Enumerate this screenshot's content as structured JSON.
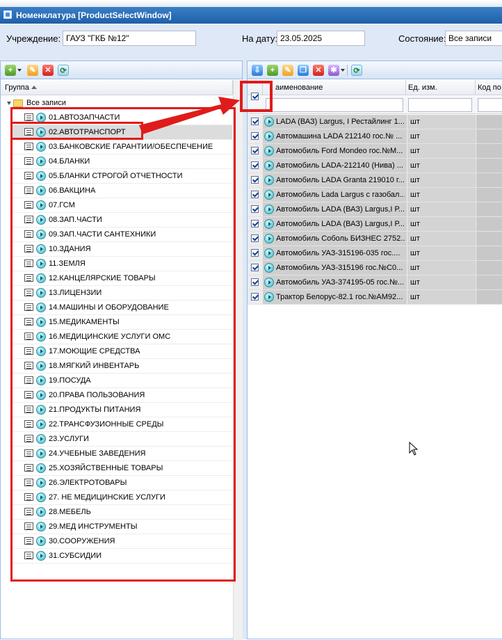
{
  "window": {
    "title": "Номенклатура [ProductSelectWindow]"
  },
  "filters": {
    "institution_label": "Учреждение:",
    "institution_value": "ГАУЗ \"ГКБ №12\"",
    "date_label": "На дату:",
    "date_value": "23.05.2025",
    "state_label": "Состояние:",
    "state_value": "Все записи"
  },
  "left_panel": {
    "column_header": "Группа",
    "root_label": "Все записи",
    "selected_index": 1,
    "groups": [
      "01.АВТОЗАПЧАСТИ",
      "02.АВТОТРАНСПОРТ",
      "03.БАНКОВСКИЕ ГАРАНТИИ/ОБЕСПЕЧЕНИЕ",
      "04.БЛАНКИ",
      "05.БЛАНКИ СТРОГОЙ ОТЧЕТНОСТИ",
      "06.ВАКЦИНА",
      "07.ГСМ",
      "08.ЗАП.ЧАСТИ",
      "09.ЗАП.ЧАСТИ САНТЕХНИКИ",
      "10.ЗДАНИЯ",
      "11.ЗЕМЛЯ",
      "12.КАНЦЕЛЯРСКИЕ ТОВАРЫ",
      "13.ЛИЦЕНЗИИ",
      "14.МАШИНЫ И ОБОРУДОВАНИЕ",
      "15.МЕДИКАМЕНТЫ",
      "16.МЕДИЦИНСКИЕ УСЛУГИ ОМС",
      "17.МОЮЩИЕ СРЕДСТВА",
      "18.МЯГКИЙ ИНВЕНТАРЬ",
      "19.ПОСУДА",
      "20.ПРАВА ПОЛЬЗОВАНИЯ",
      "21.ПРОДУКТЫ ПИТАНИЯ",
      "22.ТРАНСФУЗИОННЫЕ СРЕДЫ",
      "23.УСЛУГИ",
      "24.УЧЕБНЫЕ ЗАВЕДЕНИЯ",
      "25.ХОЗЯЙСТВЕННЫЕ ТОВАРЫ",
      "26.ЭЛЕКТРОТОВАРЫ",
      "27. НЕ МЕДИЦИНСКИЕ УСЛУГИ",
      "28.МЕБЕЛЬ",
      "29.МЕД ИНСТРУМЕНТЫ",
      "30.СООРУЖЕНИЯ",
      "31.СУБСИДИИ"
    ]
  },
  "right_panel": {
    "columns": {
      "name": "аименование",
      "unit": "Ед. изм.",
      "code": "Код по"
    },
    "header_checkbox_checked": true,
    "rows": [
      {
        "name": "LADA (ВАЗ) Largus, I Рестайлинг 1...",
        "unit": "шт",
        "checked": true
      },
      {
        "name": "Автомашина LADA 212140 гос.№ ...",
        "unit": "шт",
        "checked": true
      },
      {
        "name": "Автомобиль Ford Mondeo гос.№М...",
        "unit": "шт",
        "checked": true
      },
      {
        "name": "Автомобиль LADA-212140 (Нива) ...",
        "unit": "шт",
        "checked": true
      },
      {
        "name": "Автомобиль LADA Granta 219010 г...",
        "unit": "шт",
        "checked": true
      },
      {
        "name": "Автомобиль Lada Largus с газобал...",
        "unit": "шт",
        "checked": true
      },
      {
        "name": "Автомобиль LADA (ВАЗ) Largus,I Р...",
        "unit": "шт",
        "checked": true
      },
      {
        "name": "Автомобиль LADA (ВАЗ) Largus,I Р...",
        "unit": "шт",
        "checked": true
      },
      {
        "name": "Автомобиль Соболь БИЗНЕС 2752...",
        "unit": "шт",
        "checked": true
      },
      {
        "name": "Автомобиль УАЗ-315196-035 гос....",
        "unit": "шт",
        "checked": true
      },
      {
        "name": "Автомобиль УАЗ-315196 гос.№С0...",
        "unit": "шт",
        "checked": true
      },
      {
        "name": "Автомобиль УАЗ-374195-05 гос.№...",
        "unit": "шт",
        "checked": true
      },
      {
        "name": "Трактор Белорус-82.1 гос.№АМ92...",
        "unit": "шт",
        "checked": true
      }
    ]
  },
  "icons": {
    "left_toolbar": [
      "add-icon",
      "dropdown-arrow-icon",
      "edit-icon",
      "delete-icon",
      "refresh-icon"
    ],
    "right_toolbar": [
      "download-icon",
      "add-icon",
      "edit-icon",
      "copy-icon",
      "delete-icon",
      "settings-icon",
      "dropdown-arrow-icon",
      "refresh-icon"
    ]
  },
  "colors": {
    "annotation": "#e01b1b",
    "titlebar": "#1f5fa8",
    "panel_bg": "#dfe8f6"
  }
}
